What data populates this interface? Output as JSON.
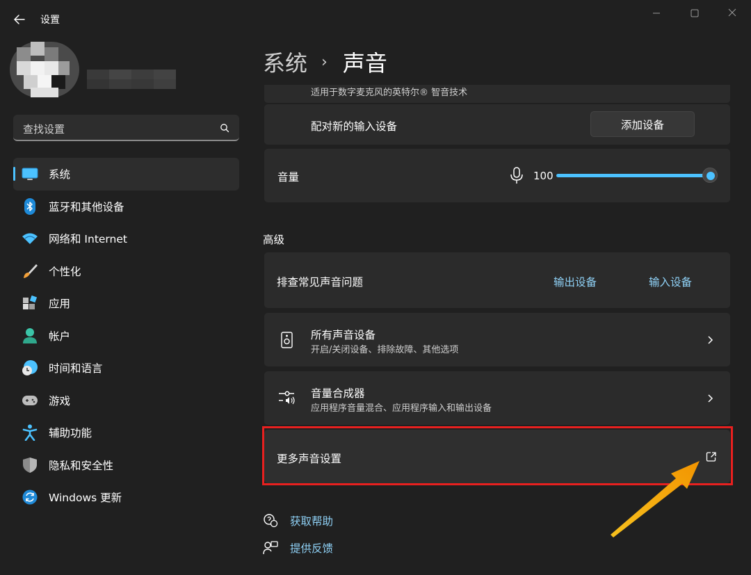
{
  "window": {
    "title": "设置",
    "controls": [
      "minimize-icon",
      "maximize-icon",
      "close-icon"
    ]
  },
  "sidebar": {
    "search_placeholder": "查找设置",
    "items": [
      {
        "label": "系统",
        "icon": "system-icon",
        "active": true
      },
      {
        "label": "蓝牙和其他设备",
        "icon": "bluetooth-icon"
      },
      {
        "label": "网络和 Internet",
        "icon": "network-icon"
      },
      {
        "label": "个性化",
        "icon": "brush-icon"
      },
      {
        "label": "应用",
        "icon": "apps-icon"
      },
      {
        "label": "帐户",
        "icon": "account-icon"
      },
      {
        "label": "时间和语言",
        "icon": "time-language-icon"
      },
      {
        "label": "游戏",
        "icon": "gaming-icon"
      },
      {
        "label": "辅助功能",
        "icon": "accessibility-icon"
      },
      {
        "label": "隐私和安全性",
        "icon": "shield-icon"
      },
      {
        "label": "Windows 更新",
        "icon": "windows-update-icon"
      }
    ]
  },
  "main": {
    "breadcrumb": {
      "parent": "系统",
      "separator": "›",
      "current": "声音"
    },
    "partial_subtitle": "适用于数字麦克风的英特尔® 智音技术",
    "pair_input": {
      "label": "配对新的输入设备",
      "button": "添加设备"
    },
    "volume": {
      "label": "音量",
      "value": "100",
      "level": 1.0
    },
    "advanced": {
      "title": "高级",
      "troubleshoot": {
        "label": "排查常见声音问题",
        "link_output": "输出设备",
        "link_input": "输入设备"
      },
      "all_devices": {
        "title": "所有声音设备",
        "subtitle": "开启/关闭设备、排除故障、其他选项"
      },
      "mixer": {
        "title": "音量合成器",
        "subtitle": "应用程序音量混合、应用程序输入和输出设备"
      },
      "more_settings": {
        "label": "更多声音设置"
      }
    },
    "footer": {
      "help": "获取帮助",
      "feedback": "提供反馈"
    }
  },
  "colors": {
    "accent": "#4cc2ff",
    "link": "#8fd1f6",
    "highlight_frame": "#e8201f",
    "arrow": "#f5a800"
  }
}
